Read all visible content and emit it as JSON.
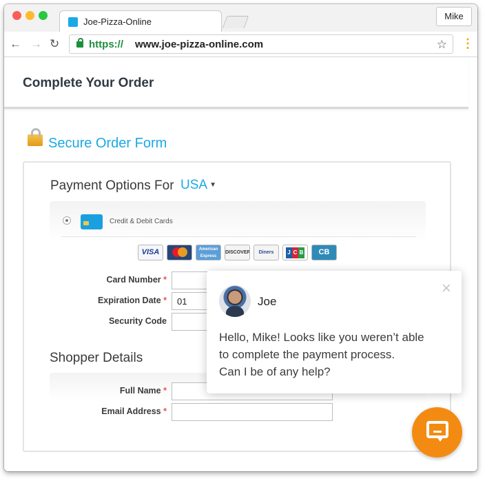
{
  "browser": {
    "tab_title": "Joe-Pizza-Online",
    "profile": "Mike",
    "url_scheme": "https://",
    "url_host": "www.joe-pizza-online.com",
    "icons": [
      "back-arrow-icon",
      "forward-arrow-icon",
      "reload-icon",
      "lock-icon",
      "star-icon",
      "menu-icon"
    ]
  },
  "page": {
    "title": "Complete Your Order",
    "secure_title": "Secure Order Form"
  },
  "payment": {
    "heading": "Payment Options For",
    "country": "USA",
    "method_label": "Credit & Debit Cards",
    "card_logos": [
      "VISA",
      "MasterCard",
      "American Express",
      "DISCOVER",
      "Diners Club",
      "JCB",
      "CB"
    ],
    "fields": [
      {
        "label": "Card Number",
        "value": ""
      },
      {
        "label": "Expiration Date",
        "value": "01"
      },
      {
        "label": "Security Code",
        "value": ""
      }
    ]
  },
  "shopper": {
    "heading": "Shopper Details",
    "fields": [
      {
        "label": "Full Name",
        "value": ""
      },
      {
        "label": "Email Address",
        "value": ""
      }
    ]
  },
  "chat": {
    "agent_name": "Joe",
    "message_lines": [
      "Hello, Mike! Looks like you weren’t able",
      "to complete the payment process.",
      "Can I be of any help?"
    ],
    "close_glyph": "×"
  },
  "colors": {
    "accent": "#1aa9e6",
    "launcher": "#f38b13",
    "required": "#e2574c"
  }
}
